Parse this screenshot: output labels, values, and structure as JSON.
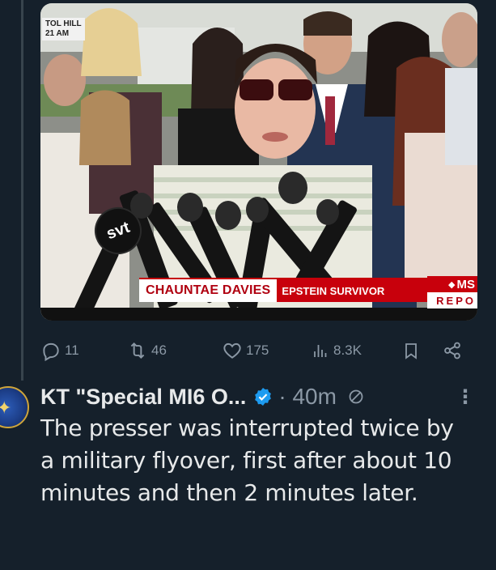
{
  "media": {
    "station_bug_line1": "TOL HILL",
    "station_bug_line2": "21 AM",
    "lower_third_name": "CHAUNTAE DAVIES",
    "lower_third_title": "EPSTEIN SURVIVOR",
    "network_logo_top": "MS",
    "network_logo_bottom": "REPO",
    "mic_flag_text": "svt"
  },
  "actions": {
    "reply_count": "11",
    "repost_count": "46",
    "like_count": "175",
    "view_count": "8.3K"
  },
  "tweet": {
    "author_name": "KT \"Special MI6 O...",
    "separator": "·",
    "timestamp": "40m",
    "more_label": "⋮",
    "text": "The presser was interrupted twice by a military flyover, first after about 10 minutes and then 2 minutes later."
  },
  "icons": {
    "reply": "reply-icon",
    "repost": "repost-icon",
    "like": "like-icon",
    "views": "views-icon",
    "bookmark": "bookmark-icon",
    "share": "share-icon",
    "verified": "verified-badge-icon",
    "edited": "edited-icon"
  },
  "colors": {
    "background": "#15202b",
    "text": "#e7e9ea",
    "muted": "#8b98a5",
    "verified": "#1d9bf0",
    "news_red": "#c8000c"
  }
}
